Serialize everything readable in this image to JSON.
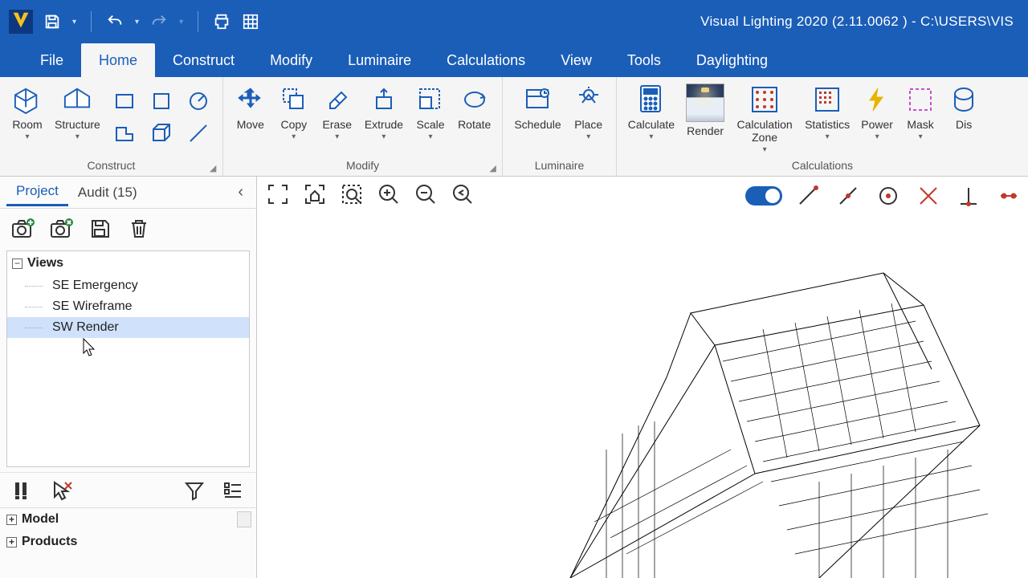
{
  "title": "Visual Lighting 2020 (2.11.0062 ) - C:\\USERS\\VIS",
  "menu": {
    "tabs": [
      "File",
      "Home",
      "Construct",
      "Modify",
      "Luminaire",
      "Calculations",
      "View",
      "Tools",
      "Daylighting"
    ],
    "active": "Home"
  },
  "ribbon": {
    "groups": {
      "construct": {
        "label": "Construct",
        "room": "Room",
        "structure": "Structure"
      },
      "modify": {
        "label": "Modify",
        "move": "Move",
        "copy": "Copy",
        "erase": "Erase",
        "extrude": "Extrude",
        "scale": "Scale",
        "rotate": "Rotate"
      },
      "luminaire": {
        "label": "Luminaire",
        "schedule": "Schedule",
        "place": "Place"
      },
      "calculations": {
        "label": "Calculations",
        "calculate": "Calculate",
        "render": "Render",
        "zone": "Calculation Zone",
        "statistics": "Statistics",
        "power": "Power",
        "mask": "Mask",
        "dist": "Dis"
      }
    }
  },
  "sidebar": {
    "tabs": {
      "project": "Project",
      "audit": "Audit (15)",
      "active": "Project"
    },
    "tree": {
      "header": "Views",
      "items": [
        "SE Emergency",
        "SE Wireframe",
        "SW Render"
      ],
      "selected_index": 2
    },
    "bottom": {
      "model": "Model",
      "products": "Products"
    }
  }
}
